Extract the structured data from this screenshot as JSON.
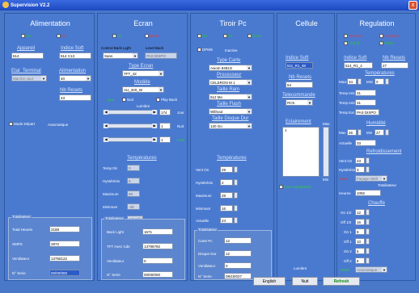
{
  "window": {
    "title": "Supervision V2.2",
    "close": "x"
  },
  "alimentation": {
    "title": "Alimentation",
    "on": "On",
    "off": "Off",
    "appareil_label": "Appareil",
    "appareil": "514",
    "indice_soft_label": "Indice Soft",
    "indice_soft": "514 C13",
    "etat_terminal_label": "Etat_Terminal",
    "etat_terminal": "Marche-Jour",
    "alimentation_label": "Alimentation",
    "alimentation": "40",
    "nb_resets_label": "Nb Resets",
    "nb_resets": "43",
    "mode_depart_label": "Mode Départ",
    "mode_depart": "Automatique",
    "totalisateur_label": "Totalisateur",
    "total_heures_label": "Total Heures",
    "total_heures": "2188",
    "smps_label": "SMPS",
    "smps": "2872",
    "ventilateur_label": "Ventilateur",
    "ventilateur": "13755122",
    "n_serie_label": "N° Serie",
    "n_serie": "00/00/000"
  },
  "ecran": {
    "title": "Ecran",
    "on": "On",
    "off": "Eteint",
    "control_back_light_label": "Control Back Light",
    "control_back_light": "Sans",
    "level_back_label": "Level Back",
    "level_back": "PAS DISPO",
    "type_ecran_label": "Type Ecran",
    "type_ecran": "TFT_42",
    "modele_label": "Modèle",
    "modele": "AU_320_W",
    "tft_label": "TFT",
    "noir_label": "Noir",
    "play_back_label": "Play Back",
    "lumiere_label": "Lumière",
    "jour_label": "Jour",
    "jour": "174",
    "nuit_label": "Nuit",
    "nuit": "1",
    "auto_label": "Auto",
    "auto": "1",
    "temperatures_label": "Températures",
    "temp_dir_label": "Temp Dir",
    "temp_dir": "0",
    "hysteresis_label": "Hystérésis",
    "hysteresis": "5",
    "maximum_label": "Maximum",
    "maximum": "50",
    "minimum_label": "Minimum",
    "minimum": "-25",
    "actuelle_label": "Actuelle",
    "actuelle": "Actuelle",
    "totalisateur_label": "Totalisateur",
    "back_light_label": "Back Light",
    "back_light": "1671",
    "tft_avec_cde_label": "TFT Avec Cde",
    "tft_avec_cde": "13796792",
    "ventilateur_label": "Ventilateur",
    "ventilateur": "0",
    "n_serie_label": "N° Serie",
    "n_serie": "00/00/000"
  },
  "tiroir": {
    "title": "Tiroir Pc",
    "on": "On",
    "pc": "Pc",
    "ecran": "Ecran",
    "dpms_label": "DPMS",
    "dpms": "Inactive",
    "type_carte_label": "Type Carte",
    "type_carte": "Axiom 8481G",
    "processeur_label": "Processeur",
    "processeur": "CELERON M 1",
    "taille_ram_label": "Taille Ram",
    "taille_ram": "512 Mo",
    "taille_flash_label": "Taille Flash",
    "taille_flash": "Without",
    "taille_disque_label": "Taille Disque Dur",
    "taille_disque": "120 Go",
    "temperatures_label": "Températures",
    "vent_on_label": "Vent On",
    "vent_on": "29",
    "hysteresis_label": "Hystérésis",
    "hysteresis": "2",
    "maximum_label": "Maximum",
    "maximum": "28",
    "minimum_label": "Minimum",
    "minimum": "16",
    "actuelle_label": "Actuelle",
    "actuelle": "24",
    "totalisateur_label": "Totalisateur",
    "carte_pc_label": "Carte Pc",
    "carte_pc": "12",
    "disque_dur_label": "Disque Dur",
    "disque_dur": "12",
    "ventilateur_label": "Ventilateur",
    "ventilateur": "0",
    "n_serie_label": "N° Serie",
    "n_serie": "08/10/027"
  },
  "cellule": {
    "title": "Cellule",
    "indice_soft_label": "Indice Soft",
    "indice_soft": "511_R1_48",
    "nb_resets_label": "Nb Resets",
    "nb_resets": "64",
    "telecommande_label": "Telecommande",
    "telecommande": "RC5",
    "eclairement_label": "Eclairement",
    "eclairement": "1",
    "max_label": "Max",
    "min_label": "Min",
    "avec_ajustement_label": "Avec Ajustement",
    "lumiere_label": "Lumière"
  },
  "regulation": {
    "title": "Regulation",
    "temp_int": "Temp Int",
    "temp_ext": "Temp Ext",
    "chauff": "Chauff",
    "ventil": "Ventil",
    "indice_soft_label": "Indice Soft",
    "indice_soft": "514_R1_4",
    "nb_resets_label": "Nb Resets",
    "nb_resets": "27",
    "temperatures_label": "Températures",
    "maxi_label": "Maxi",
    "maxi": "34",
    "mini_label": "Mini",
    "mini": "0",
    "temp_int1_label": "Temp Int1",
    "temp_int1": "31",
    "temp_int2_label": "Temp Int2",
    "temp_int2": "31",
    "temp_ext_label": "Temp Ext",
    "temp_ext_val": "PAS DISPO",
    "humidite_label": "Humidité",
    "hum_max_label": "Max",
    "hum_max": "26",
    "hum_min_label": "Min",
    "hum_min": "27",
    "hum_actuelle_label": "Actuelle",
    "hum_actuelle": "33",
    "refroidissement_label": "Refroidissement",
    "vent_on_label": "Vent On",
    "vent_on": "23",
    "hysteresis_label": "Hystérésis",
    "hysteresis": "3",
    "mode_label": "Mode",
    "mode": "Façage Atteli",
    "heures_label": "Heures",
    "totalisateur_label": "Totalisateur",
    "heures": "1092",
    "chauffe_label": "Chauffe",
    "on12_label": "On 1/2",
    "on12": "12",
    "off12_label": "Off 1/2",
    "off12": "16",
    "on1_label": "On 1",
    "on1": "8",
    "off1_label": "Off 1",
    "off1": "10",
    "on2_label": "On 2",
    "on2": "5",
    "off2_label": "Off 2",
    "off2": "8",
    "mode2_label": "Mode",
    "mode2": "Automatique"
  },
  "buttons": {
    "english": "English",
    "nuit": "Nuit",
    "refresh": "Refresh"
  }
}
